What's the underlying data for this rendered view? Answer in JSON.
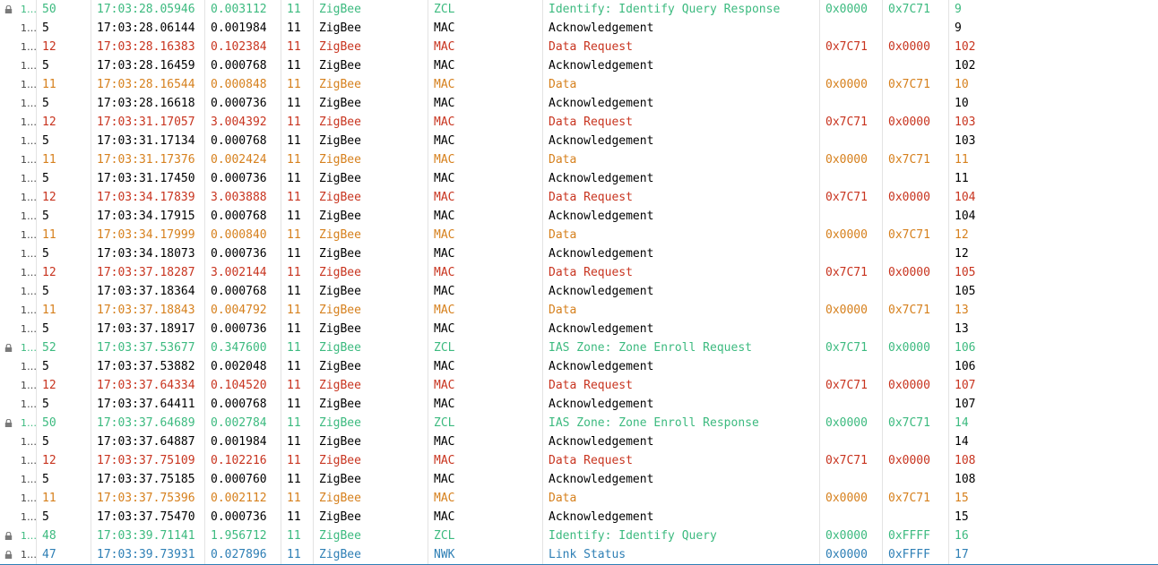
{
  "packets": [
    {
      "index": "1…",
      "len": "50",
      "time": "17:03:28.05946",
      "delta": "0.003112",
      "ch": "11",
      "proto": "ZigBee",
      "layer": "ZCL",
      "info": "Identify: Identify Query Response",
      "src": "0x0000",
      "dst": "0x7C71",
      "seq": "9",
      "kind": "zcl",
      "lock": true
    },
    {
      "index": "1…",
      "len": "5",
      "time": "17:03:28.06144",
      "delta": "0.001984",
      "ch": "11",
      "proto": "ZigBee",
      "layer": "MAC",
      "info": "Acknowledgement",
      "src": "",
      "dst": "",
      "seq": "9",
      "kind": "ack",
      "lock": false
    },
    {
      "index": "1…",
      "len": "12",
      "time": "17:03:28.16383",
      "delta": "0.102384",
      "ch": "11",
      "proto": "ZigBee",
      "layer": "MAC",
      "info": "Data Request",
      "src": "0x7C71",
      "dst": "0x0000",
      "seq": "102",
      "kind": "req",
      "lock": false
    },
    {
      "index": "1…",
      "len": "5",
      "time": "17:03:28.16459",
      "delta": "0.000768",
      "ch": "11",
      "proto": "ZigBee",
      "layer": "MAC",
      "info": "Acknowledgement",
      "src": "",
      "dst": "",
      "seq": "102",
      "kind": "ack",
      "lock": false
    },
    {
      "index": "1…",
      "len": "11",
      "time": "17:03:28.16544",
      "delta": "0.000848",
      "ch": "11",
      "proto": "ZigBee",
      "layer": "MAC",
      "info": "Data",
      "src": "0x0000",
      "dst": "0x7C71",
      "seq": "10",
      "kind": "data",
      "lock": false
    },
    {
      "index": "1…",
      "len": "5",
      "time": "17:03:28.16618",
      "delta": "0.000736",
      "ch": "11",
      "proto": "ZigBee",
      "layer": "MAC",
      "info": "Acknowledgement",
      "src": "",
      "dst": "",
      "seq": "10",
      "kind": "ack",
      "lock": false
    },
    {
      "index": "1…",
      "len": "12",
      "time": "17:03:31.17057",
      "delta": "3.004392",
      "ch": "11",
      "proto": "ZigBee",
      "layer": "MAC",
      "info": "Data Request",
      "src": "0x7C71",
      "dst": "0x0000",
      "seq": "103",
      "kind": "req",
      "lock": false
    },
    {
      "index": "1…",
      "len": "5",
      "time": "17:03:31.17134",
      "delta": "0.000768",
      "ch": "11",
      "proto": "ZigBee",
      "layer": "MAC",
      "info": "Acknowledgement",
      "src": "",
      "dst": "",
      "seq": "103",
      "kind": "ack",
      "lock": false
    },
    {
      "index": "1…",
      "len": "11",
      "time": "17:03:31.17376",
      "delta": "0.002424",
      "ch": "11",
      "proto": "ZigBee",
      "layer": "MAC",
      "info": "Data",
      "src": "0x0000",
      "dst": "0x7C71",
      "seq": "11",
      "kind": "data",
      "lock": false
    },
    {
      "index": "1…",
      "len": "5",
      "time": "17:03:31.17450",
      "delta": "0.000736",
      "ch": "11",
      "proto": "ZigBee",
      "layer": "MAC",
      "info": "Acknowledgement",
      "src": "",
      "dst": "",
      "seq": "11",
      "kind": "ack",
      "lock": false
    },
    {
      "index": "1…",
      "len": "12",
      "time": "17:03:34.17839",
      "delta": "3.003888",
      "ch": "11",
      "proto": "ZigBee",
      "layer": "MAC",
      "info": "Data Request",
      "src": "0x7C71",
      "dst": "0x0000",
      "seq": "104",
      "kind": "req",
      "lock": false
    },
    {
      "index": "1…",
      "len": "5",
      "time": "17:03:34.17915",
      "delta": "0.000768",
      "ch": "11",
      "proto": "ZigBee",
      "layer": "MAC",
      "info": "Acknowledgement",
      "src": "",
      "dst": "",
      "seq": "104",
      "kind": "ack",
      "lock": false
    },
    {
      "index": "1…",
      "len": "11",
      "time": "17:03:34.17999",
      "delta": "0.000840",
      "ch": "11",
      "proto": "ZigBee",
      "layer": "MAC",
      "info": "Data",
      "src": "0x0000",
      "dst": "0x7C71",
      "seq": "12",
      "kind": "data",
      "lock": false
    },
    {
      "index": "1…",
      "len": "5",
      "time": "17:03:34.18073",
      "delta": "0.000736",
      "ch": "11",
      "proto": "ZigBee",
      "layer": "MAC",
      "info": "Acknowledgement",
      "src": "",
      "dst": "",
      "seq": "12",
      "kind": "ack",
      "lock": false
    },
    {
      "index": "1…",
      "len": "12",
      "time": "17:03:37.18287",
      "delta": "3.002144",
      "ch": "11",
      "proto": "ZigBee",
      "layer": "MAC",
      "info": "Data Request",
      "src": "0x7C71",
      "dst": "0x0000",
      "seq": "105",
      "kind": "req",
      "lock": false
    },
    {
      "index": "1…",
      "len": "5",
      "time": "17:03:37.18364",
      "delta": "0.000768",
      "ch": "11",
      "proto": "ZigBee",
      "layer": "MAC",
      "info": "Acknowledgement",
      "src": "",
      "dst": "",
      "seq": "105",
      "kind": "ack",
      "lock": false
    },
    {
      "index": "1…",
      "len": "11",
      "time": "17:03:37.18843",
      "delta": "0.004792",
      "ch": "11",
      "proto": "ZigBee",
      "layer": "MAC",
      "info": "Data",
      "src": "0x0000",
      "dst": "0x7C71",
      "seq": "13",
      "kind": "data",
      "lock": false
    },
    {
      "index": "1…",
      "len": "5",
      "time": "17:03:37.18917",
      "delta": "0.000736",
      "ch": "11",
      "proto": "ZigBee",
      "layer": "MAC",
      "info": "Acknowledgement",
      "src": "",
      "dst": "",
      "seq": "13",
      "kind": "ack",
      "lock": false
    },
    {
      "index": "1…",
      "len": "52",
      "time": "17:03:37.53677",
      "delta": "0.347600",
      "ch": "11",
      "proto": "ZigBee",
      "layer": "ZCL",
      "info": "IAS Zone: Zone Enroll Request",
      "src": "0x7C71",
      "dst": "0x0000",
      "seq": "106",
      "kind": "zcl",
      "lock": true
    },
    {
      "index": "1…",
      "len": "5",
      "time": "17:03:37.53882",
      "delta": "0.002048",
      "ch": "11",
      "proto": "ZigBee",
      "layer": "MAC",
      "info": "Acknowledgement",
      "src": "",
      "dst": "",
      "seq": "106",
      "kind": "ack",
      "lock": false
    },
    {
      "index": "1…",
      "len": "12",
      "time": "17:03:37.64334",
      "delta": "0.104520",
      "ch": "11",
      "proto": "ZigBee",
      "layer": "MAC",
      "info": "Data Request",
      "src": "0x7C71",
      "dst": "0x0000",
      "seq": "107",
      "kind": "req",
      "lock": false
    },
    {
      "index": "1…",
      "len": "5",
      "time": "17:03:37.64411",
      "delta": "0.000768",
      "ch": "11",
      "proto": "ZigBee",
      "layer": "MAC",
      "info": "Acknowledgement",
      "src": "",
      "dst": "",
      "seq": "107",
      "kind": "ack",
      "lock": false
    },
    {
      "index": "1…",
      "len": "50",
      "time": "17:03:37.64689",
      "delta": "0.002784",
      "ch": "11",
      "proto": "ZigBee",
      "layer": "ZCL",
      "info": "IAS Zone: Zone Enroll Response",
      "src": "0x0000",
      "dst": "0x7C71",
      "seq": "14",
      "kind": "zcl",
      "lock": true
    },
    {
      "index": "1…",
      "len": "5",
      "time": "17:03:37.64887",
      "delta": "0.001984",
      "ch": "11",
      "proto": "ZigBee",
      "layer": "MAC",
      "info": "Acknowledgement",
      "src": "",
      "dst": "",
      "seq": "14",
      "kind": "ack",
      "lock": false
    },
    {
      "index": "1…",
      "len": "12",
      "time": "17:03:37.75109",
      "delta": "0.102216",
      "ch": "11",
      "proto": "ZigBee",
      "layer": "MAC",
      "info": "Data Request",
      "src": "0x7C71",
      "dst": "0x0000",
      "seq": "108",
      "kind": "req",
      "lock": false
    },
    {
      "index": "1…",
      "len": "5",
      "time": "17:03:37.75185",
      "delta": "0.000760",
      "ch": "11",
      "proto": "ZigBee",
      "layer": "MAC",
      "info": "Acknowledgement",
      "src": "",
      "dst": "",
      "seq": "108",
      "kind": "ack",
      "lock": false
    },
    {
      "index": "1…",
      "len": "11",
      "time": "17:03:37.75396",
      "delta": "0.002112",
      "ch": "11",
      "proto": "ZigBee",
      "layer": "MAC",
      "info": "Data",
      "src": "0x0000",
      "dst": "0x7C71",
      "seq": "15",
      "kind": "data",
      "lock": false
    },
    {
      "index": "1…",
      "len": "5",
      "time": "17:03:37.75470",
      "delta": "0.000736",
      "ch": "11",
      "proto": "ZigBee",
      "layer": "MAC",
      "info": "Acknowledgement",
      "src": "",
      "dst": "",
      "seq": "15",
      "kind": "ack",
      "lock": false
    },
    {
      "index": "1…",
      "len": "48",
      "time": "17:03:39.71141",
      "delta": "1.956712",
      "ch": "11",
      "proto": "ZigBee",
      "layer": "ZCL",
      "info": "Identify: Identify Query",
      "src": "0x0000",
      "dst": "0xFFFF",
      "seq": "16",
      "kind": "zcl",
      "lock": true
    },
    {
      "index": "1…",
      "len": "47",
      "time": "17:03:39.73931",
      "delta": "0.027896",
      "ch": "11",
      "proto": "ZigBee",
      "layer": "NWK",
      "info": "Link Status",
      "src": "0x0000",
      "dst": "0xFFFF",
      "seq": "17",
      "kind": "nwk",
      "lock": true
    }
  ],
  "colors": {
    "zcl": "#3cba7f",
    "req": "#c8341f",
    "data": "#d6801d",
    "ack": "#000000",
    "nwk": "#2e7fb5"
  },
  "icons": {
    "lock": "lock-icon"
  }
}
